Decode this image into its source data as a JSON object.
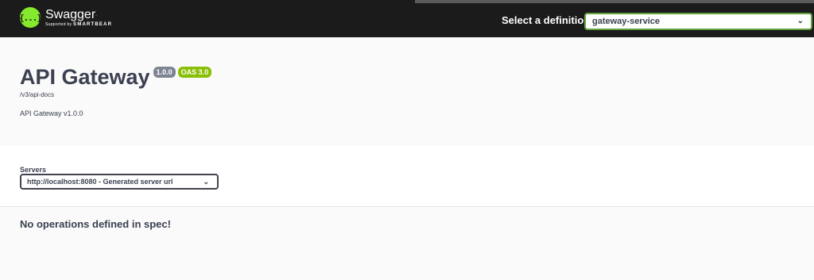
{
  "topbar": {
    "logo_glyph": "{...}",
    "logo_title": "Swagger",
    "logo_tm": ".",
    "logo_sub_prefix": "Supported by",
    "logo_sub_brand": "SMARTBEAR",
    "definition_label": "Select a definition",
    "definition_value": "gateway-service"
  },
  "info": {
    "title": "API Gateway",
    "version_badge": "1.0.0",
    "oas_badge": "OAS 3.0",
    "docs_link": "/v3/api-docs",
    "description": "API Gateway v1.0.0"
  },
  "servers": {
    "label": "Servers",
    "selected": "http://localhost:8080 - Generated server url"
  },
  "operations": {
    "empty_message": "No operations defined in spec!"
  },
  "colors": {
    "topbar_bg": "#1b1b1b",
    "accent_green": "#85ea2d",
    "select_border": "#62a03f",
    "version_badge": "#7d8492",
    "oas_badge": "#89bf04",
    "text": "#3b4151"
  },
  "icons": {
    "logo": "swagger-logo-icon",
    "dropdown": "chevron-down-icon"
  }
}
